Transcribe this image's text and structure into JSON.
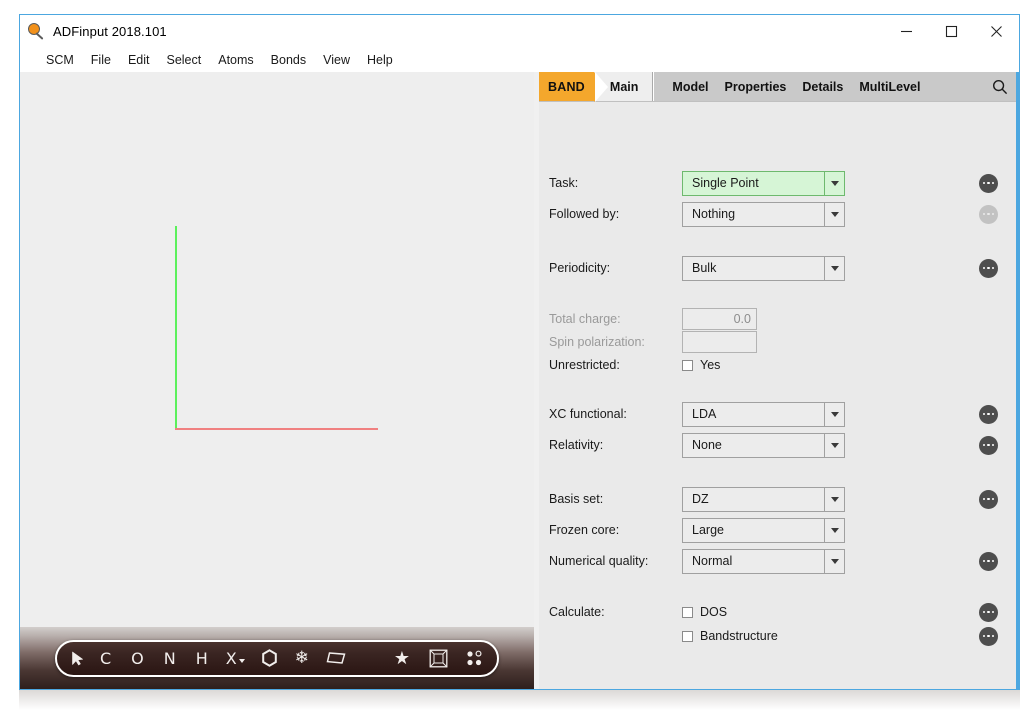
{
  "window": {
    "title": "ADFinput 2018.101",
    "app_icon": "magnifier-icon",
    "controls": {
      "minimize": "minimize-icon",
      "maximize": "maximize-icon",
      "close": "close-icon"
    }
  },
  "menubar": {
    "items": [
      {
        "label": "SCM"
      },
      {
        "label": "File"
      },
      {
        "label": "Edit"
      },
      {
        "label": "Select"
      },
      {
        "label": "Atoms"
      },
      {
        "label": "Bonds"
      },
      {
        "label": "View"
      },
      {
        "label": "Help"
      }
    ]
  },
  "viewport": {
    "axes": [
      {
        "name": "y-axis",
        "color": "#5bf05b"
      },
      {
        "name": "x-axis",
        "color": "#f08080"
      }
    ],
    "background_color": "#eeeeee"
  },
  "tool_palette": {
    "items": [
      {
        "name": "select-arrow-icon",
        "glyph": "➤"
      },
      {
        "name": "carbon-atom-icon",
        "glyph": "C"
      },
      {
        "name": "oxygen-atom-icon",
        "glyph": "O"
      },
      {
        "name": "nitrogen-atom-icon",
        "glyph": "N"
      },
      {
        "name": "hydrogen-atom-icon",
        "glyph": "H"
      },
      {
        "name": "other-element-icon",
        "glyph": "X"
      },
      {
        "name": "benzene-ring-icon",
        "glyph": "⬡"
      },
      {
        "name": "crystal-icon",
        "glyph": "❄"
      },
      {
        "name": "plane-slab-icon",
        "glyph": "▱"
      },
      {
        "name": "favorites-star-icon",
        "glyph": "★"
      },
      {
        "name": "unit-cell-icon",
        "glyph": "▣"
      },
      {
        "name": "lattice-points-icon",
        "glyph": "⁙"
      }
    ]
  },
  "tabbar": {
    "program_badge": "BAND",
    "active_tab": "Main",
    "tabs": [
      {
        "label": "Model"
      },
      {
        "label": "Properties"
      },
      {
        "label": "Details"
      },
      {
        "label": "MultiLevel"
      }
    ],
    "search_icon": "search-icon",
    "badge_color": "#f4a72c"
  },
  "form": {
    "fields": [
      {
        "label": "Task:",
        "type": "combo",
        "value": "Single Point",
        "highlight": true,
        "disabled": false,
        "more_button": "enabled"
      },
      {
        "label": "Followed by:",
        "type": "combo",
        "value": "Nothing",
        "highlight": false,
        "disabled": false,
        "more_button": "disabled"
      },
      {
        "label": "Periodicity:",
        "type": "combo",
        "value": "Bulk",
        "highlight": false,
        "disabled": false,
        "more_button": "enabled"
      },
      {
        "label": "Total charge:",
        "type": "text",
        "value": "0.0",
        "disabled": true,
        "more_button": "none"
      },
      {
        "label": "Spin polarization:",
        "type": "text",
        "value": "",
        "disabled": true,
        "more_button": "none"
      },
      {
        "label": "Unrestricted:",
        "type": "checkbox",
        "value": "Yes",
        "checked": false,
        "disabled": false,
        "more_button": "none"
      },
      {
        "label": "XC functional:",
        "type": "combo",
        "value": "LDA",
        "highlight": false,
        "disabled": false,
        "more_button": "enabled"
      },
      {
        "label": "Relativity:",
        "type": "combo",
        "value": "None",
        "highlight": false,
        "disabled": false,
        "more_button": "enabled"
      },
      {
        "label": "Basis set:",
        "type": "combo",
        "value": "DZ",
        "highlight": false,
        "disabled": false,
        "more_button": "enabled"
      },
      {
        "label": "Frozen core:",
        "type": "combo",
        "value": "Large",
        "highlight": false,
        "disabled": false,
        "more_button": "none"
      },
      {
        "label": "Numerical quality:",
        "type": "combo",
        "value": "Normal",
        "highlight": false,
        "disabled": false,
        "more_button": "enabled"
      },
      {
        "label": "Calculate:",
        "type": "checkbox",
        "value": "DOS",
        "checked": false,
        "disabled": false,
        "more_button": "enabled"
      },
      {
        "label": "",
        "type": "checkbox",
        "value": "Bandstructure",
        "checked": false,
        "disabled": false,
        "more_button": "enabled"
      }
    ]
  }
}
